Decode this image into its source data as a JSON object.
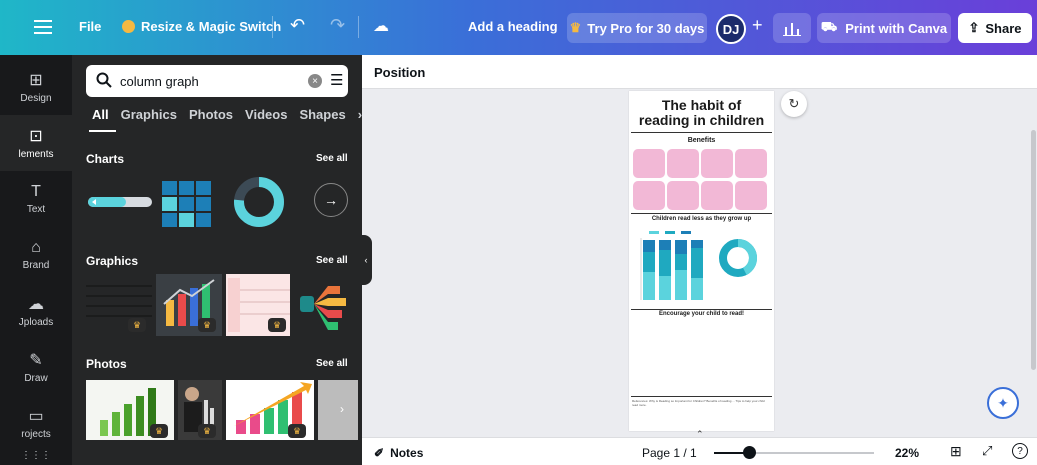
{
  "topbar": {
    "file_label": "File",
    "resize_label": "Resize & Magic Switch",
    "heading_label": "Add a heading",
    "pro_label": "Try Pro for 30 days",
    "avatar_initials": "DJ",
    "print_label": "Print with Canva",
    "share_label": "Share"
  },
  "rail": {
    "items": [
      {
        "label": "Design",
        "icon": "layout-icon"
      },
      {
        "label": "lements",
        "icon": "shapes-icon"
      },
      {
        "label": "Text",
        "icon": "text-icon"
      },
      {
        "label": "Brand",
        "icon": "brand-icon"
      },
      {
        "label": "Jploads",
        "icon": "upload-icon"
      },
      {
        "label": "Draw",
        "icon": "pen-icon"
      },
      {
        "label": "rojects",
        "icon": "folder-icon"
      }
    ]
  },
  "panel": {
    "search_value": "column graph",
    "tabs": [
      "All",
      "Graphics",
      "Photos",
      "Videos",
      "Shapes"
    ],
    "sections": {
      "charts": "Charts",
      "graphics": "Graphics",
      "photos": "Photos",
      "see_all": "See all"
    }
  },
  "editor": {
    "position_label": "Position"
  },
  "design": {
    "title_line1": "The habit of",
    "title_line2": "reading in children",
    "benefits": "Benefits",
    "chart_heading": "Children read less as they grow up",
    "cta": "Encourage your child to read!",
    "footer_note": "References: Why is Reading so Important for Children? Benefits of reading ... Tips to help your child read more."
  },
  "bottombar": {
    "notes_label": "Notes",
    "page_label": "Page 1 / 1",
    "zoom_label": "22%",
    "zoom_fraction": 0.22
  },
  "colors": {
    "accent": "#3a6fd8",
    "teal": "#1fb7c8",
    "pink": "#f2b8d6",
    "panel": "#252627"
  }
}
